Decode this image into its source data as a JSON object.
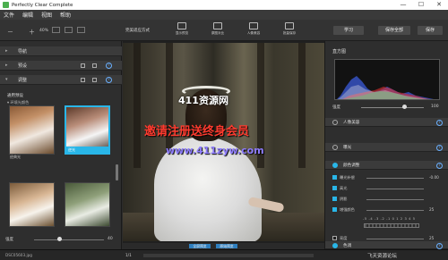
{
  "window": {
    "title": "Perfectly Clear Complete",
    "minimize": "—",
    "maximize": "☐",
    "close": "✕"
  },
  "menu": {
    "items": [
      "文件",
      "编辑",
      "视图",
      "帮助"
    ]
  },
  "toolbar": {
    "zoom_value": "40%",
    "view_mode": "完美适应方式",
    "tools": [
      {
        "label": "显示预览"
      },
      {
        "label": "原图对比"
      },
      {
        "label": "人像美容"
      },
      {
        "label": "批量保存"
      }
    ],
    "learn": "学习",
    "save_all": "保存全部",
    "save": "保存"
  },
  "left_panel": {
    "rows": [
      {
        "label": "导航"
      },
      {
        "label": "预设"
      },
      {
        "label": "调整"
      }
    ],
    "preset_heading": "通用预设",
    "preset_sub": "▾ 环境光颜色",
    "thumbs": [
      {
        "caption": "经典光"
      },
      {
        "caption": "逆光"
      },
      {
        "caption": ""
      },
      {
        "caption": ""
      }
    ],
    "strength_label": "强度",
    "strength_value": "40"
  },
  "canvas": {
    "watermark_logo": "411资源网",
    "watermark_main": "邀请注册送终身会员",
    "watermark_url": "www.411zyw.com",
    "fullscreen_button": "全屏预览",
    "original_button": "原始预览"
  },
  "right_panel": {
    "histogram_title": "直方图",
    "brightness_label": "强度",
    "brightness_value": "100",
    "sections": [
      {
        "label": "人像美容",
        "enabled": false
      },
      {
        "label": "曝光",
        "enabled": false
      },
      {
        "label": "颜色调整",
        "enabled": true
      },
      {
        "label": "色调",
        "enabled": true
      }
    ],
    "controls": [
      {
        "label": "曝光补偿",
        "value": "-0.00",
        "checked": true
      },
      {
        "label": "高光",
        "value": "",
        "checked": true
      },
      {
        "label": "阴影",
        "value": "",
        "checked": true
      },
      {
        "label": "增强颜色",
        "value": "25",
        "checked": true
      },
      {
        "label": "亮度",
        "value": "25",
        "checked": false
      }
    ],
    "scale_numbers": "-5 -4 -3 -2 -1 0 1 2 3 4 5",
    "mode_select": "中等亮度"
  },
  "statusbar": {
    "file": "DSC05603.jpg",
    "page": "1/1",
    "brand": "飞天资源论坛"
  },
  "colors": {
    "accent": "#29b6e8",
    "watermark_red": "#ff3b2f",
    "watermark_purple": "#8e7cff"
  }
}
